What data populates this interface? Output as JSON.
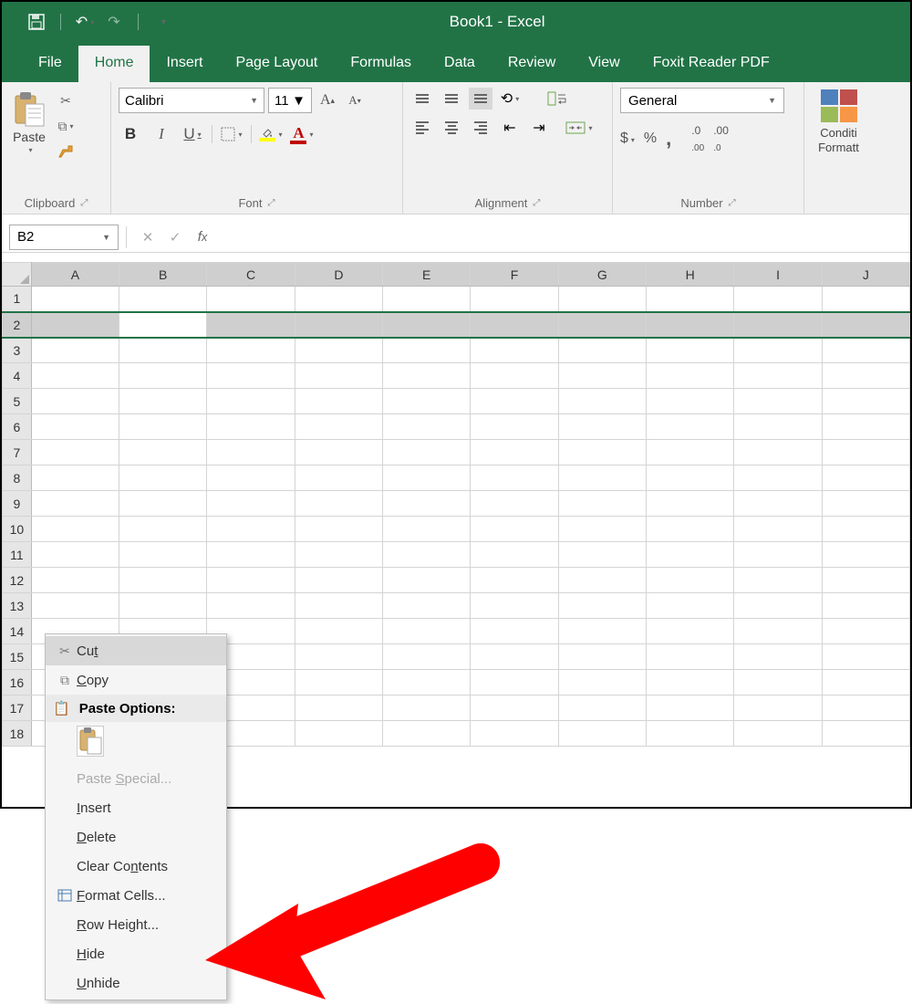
{
  "title": "Book1  -  Excel",
  "qat": {
    "save": "save",
    "undo": "undo",
    "redo": "redo"
  },
  "tabs": [
    "File",
    "Home",
    "Insert",
    "Page Layout",
    "Formulas",
    "Data",
    "Review",
    "View",
    "Foxit Reader PDF"
  ],
  "active_tab": "Home",
  "clipboard": {
    "paste": "Paste",
    "group": "Clipboard"
  },
  "font": {
    "name": "Calibri",
    "size": "11",
    "group": "Font"
  },
  "alignment": {
    "group": "Alignment"
  },
  "number": {
    "format": "General",
    "group": "Number"
  },
  "cond": {
    "label1": "Conditi",
    "label2": "Formatt"
  },
  "name_box": "B2",
  "columns": [
    "A",
    "B",
    "C",
    "D",
    "E",
    "F",
    "G",
    "H",
    "I",
    "J"
  ],
  "rows": [
    "1",
    "2",
    "3",
    "4",
    "5",
    "6",
    "7",
    "8",
    "9",
    "10",
    "11",
    "12",
    "13",
    "14",
    "15",
    "16",
    "17",
    "18"
  ],
  "selected_row": "2",
  "ctx": {
    "cut": "Cut",
    "copy": "Copy",
    "paste_options": "Paste Options:",
    "paste_special": "Paste Special...",
    "insert": "Insert",
    "delete": "Delete",
    "clear": "Clear Contents",
    "format_cells": "Format Cells...",
    "row_height": "Row Height...",
    "hide": "Hide",
    "unhide": "Unhide"
  }
}
